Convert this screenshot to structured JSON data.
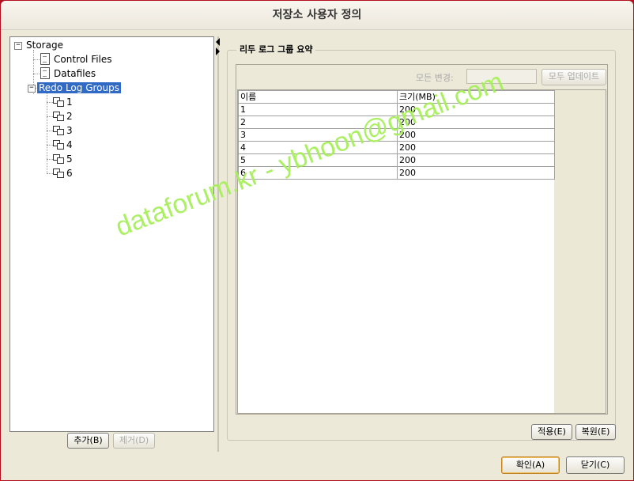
{
  "window": {
    "title": "저장소 사용자 정의"
  },
  "tree": {
    "root": "Storage",
    "children": [
      "Control Files",
      "Datafiles",
      "Redo Log Groups"
    ],
    "selected": "Redo Log Groups",
    "groups": [
      "1",
      "2",
      "3",
      "4",
      "5",
      "6"
    ]
  },
  "tree_buttons": {
    "add": "추가(B)",
    "remove": "제거(D)"
  },
  "panel": {
    "title": "리두 로그 그룹 요약",
    "change_all_label": "모든 변경:",
    "change_all_value": "",
    "update_all": "모두 업데이트"
  },
  "table": {
    "headers": [
      "이름",
      "크기(MB)"
    ],
    "rows": [
      [
        "1",
        "200"
      ],
      [
        "2",
        "200"
      ],
      [
        "3",
        "200"
      ],
      [
        "4",
        "200"
      ],
      [
        "5",
        "200"
      ],
      [
        "6",
        "200"
      ]
    ]
  },
  "panel_buttons": {
    "apply": "적용(E)",
    "revert": "복원(E)"
  },
  "dialog_buttons": {
    "ok": "확인(A)",
    "close": "닫기(C)"
  },
  "watermark": "dataforum.kr - ybhoon@gmail.com",
  "colors": {
    "selection": "#316ac5",
    "watermark": "#a6f05a",
    "frame": "#b30f1c"
  }
}
